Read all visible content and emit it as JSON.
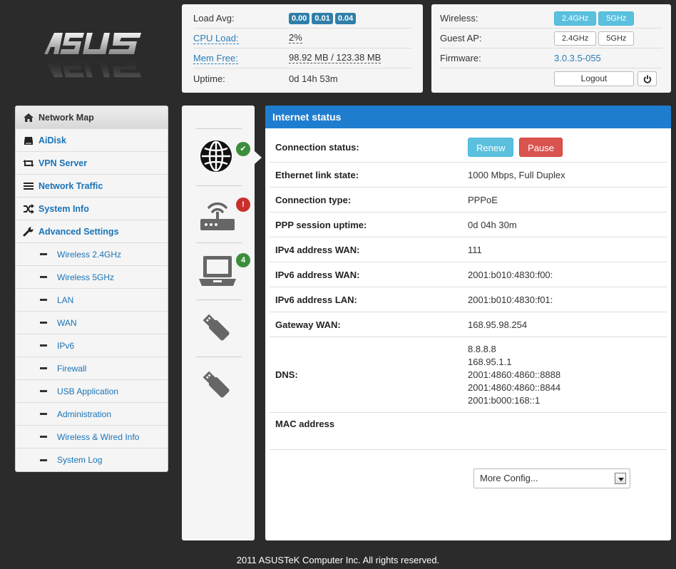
{
  "sysinfo": {
    "load_avg_label": "Load Avg:",
    "load_avg": [
      "0.00",
      "0.01",
      "0.04"
    ],
    "cpu_label": "CPU Load:",
    "cpu_value": "2%",
    "mem_label": "Mem Free:",
    "mem_value": "98.92 MB / 123.38 MB",
    "uptime_label": "Uptime:",
    "uptime_value": "0d 14h 53m"
  },
  "wireless": {
    "wireless_label": "Wireless:",
    "wireless_24": "2.4GHz",
    "wireless_5": "5GHz",
    "guest_label": "Guest AP:",
    "guest_24": "2.4GHz",
    "guest_5": "5GHz",
    "firmware_label": "Firmware:",
    "firmware_value": "3.0.3.5-055",
    "logout_label": "Logout"
  },
  "sidebar": {
    "items": [
      {
        "label": "Network Map",
        "icon": "home-icon"
      },
      {
        "label": "AiDisk",
        "icon": "disk-icon"
      },
      {
        "label": "VPN Server",
        "icon": "retweet-icon"
      },
      {
        "label": "Network Traffic",
        "icon": "list-icon"
      },
      {
        "label": "System Info",
        "icon": "shuffle-icon"
      },
      {
        "label": "Advanced Settings",
        "icon": "wrench-icon"
      }
    ],
    "subitems": [
      "Wireless 2.4GHz",
      "Wireless 5GHz",
      "LAN",
      "WAN",
      "IPv6",
      "Firewall",
      "USB Application",
      "Administration",
      "Wireless & Wired Info",
      "System Log"
    ]
  },
  "devices": {
    "clients_count": "4"
  },
  "internet": {
    "title": "Internet status",
    "connection_status_label": "Connection status:",
    "renew_label": "Renew",
    "pause_label": "Pause",
    "rows": [
      {
        "key": "Ethernet link state:",
        "value": "1000 Mbps, Full Duplex"
      },
      {
        "key": "Connection type:",
        "value": "PPPoE"
      },
      {
        "key": "PPP session uptime:",
        "value": "0d 04h 30m"
      },
      {
        "key": "IPv4 address WAN:",
        "value": "111"
      },
      {
        "key": "IPv6 address WAN:",
        "value": "2001:b010:4830:f00:"
      },
      {
        "key": "IPv6 address LAN:",
        "value": "2001:b010:4830:f01:"
      },
      {
        "key": "Gateway WAN:",
        "value": "168.95.98.254"
      }
    ],
    "dns_label": "DNS:",
    "dns": [
      "8.8.8.8",
      "168.95.1.1",
      "2001:4860:4860::8888",
      "2001:4860:4860::8844",
      "2001:b000:168::1"
    ],
    "mac_label": "MAC address",
    "mac_value": "",
    "more_config": "More Config..."
  },
  "footer": "2011 ASUSTeK Computer Inc. All rights reserved."
}
